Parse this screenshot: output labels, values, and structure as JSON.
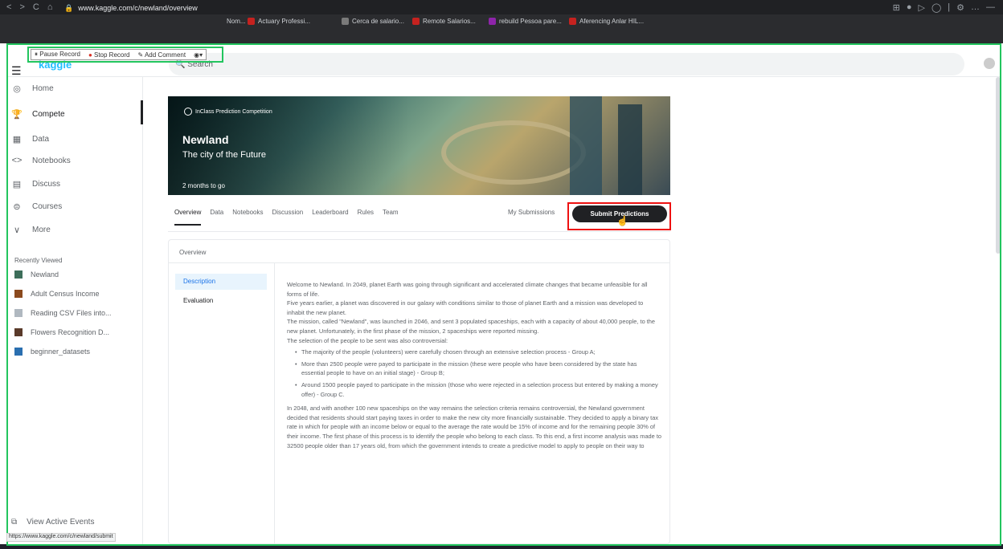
{
  "browser": {
    "url": "www.kaggle.com/c/newland/overview",
    "nav_buttons": [
      "<",
      ">",
      "C",
      "⌂"
    ],
    "right_icons": [
      "⊞",
      "●",
      "▷",
      "◯",
      "|",
      "⚙",
      "…",
      "—"
    ]
  },
  "bookmarks": [
    {
      "label": "Nom...",
      "color": "#7a7a7a"
    },
    {
      "label": "Actuary Professi...",
      "color": "#c5221f"
    },
    {
      "label": "Cerca de salario...",
      "color": "#7a7a7a"
    },
    {
      "label": "Remote Salarios...",
      "color": "#c5221f"
    },
    {
      "label": "rebuild Pessoa pare...",
      "color": "#8e24aa"
    },
    {
      "label": "Aferencing Anlar HIL...",
      "color": "#c5221f"
    }
  ],
  "recorder": {
    "pause": "Pause Record",
    "stop": "Stop Record",
    "comment": "Add Comment"
  },
  "header": {
    "logo": "kaggle",
    "search_placeholder": "Search"
  },
  "sidebar": {
    "items": [
      {
        "label": "Home",
        "icon": "◎"
      },
      {
        "label": "Compete",
        "icon": "🏆"
      },
      {
        "label": "Data",
        "icon": "▦"
      },
      {
        "label": "Notebooks",
        "icon": "<>"
      },
      {
        "label": "Discuss",
        "icon": "▤"
      },
      {
        "label": "Courses",
        "icon": "⊜"
      },
      {
        "label": "More",
        "icon": "∨"
      }
    ],
    "recent_title": "Recently Viewed",
    "recent": [
      {
        "label": "Newland",
        "color": "#3d6e5a"
      },
      {
        "label": "Adult Census Income",
        "color": "#8b4a1e"
      },
      {
        "label": "Reading CSV Files into...",
        "color": "#b0b8c0"
      },
      {
        "label": "Flowers Recognition D...",
        "color": "#5a3a2a"
      },
      {
        "label": "beginner_datasets",
        "color": "#2a6fb0"
      }
    ],
    "view_events": "View Active Events"
  },
  "status_url": "https://www.kaggle.com/c/newland/submit",
  "competition": {
    "type": "InClass Prediction Competition",
    "title": "Newland",
    "subtitle": "The city of the Future",
    "time_left": "2 months to go"
  },
  "tabs": [
    "Overview",
    "Data",
    "Notebooks",
    "Discussion",
    "Leaderboard",
    "Rules",
    "Team"
  ],
  "my_submissions": "My Submissions",
  "submit_button": "Submit Predictions",
  "overview": {
    "heading": "Overview",
    "nav": [
      "Description",
      "Evaluation"
    ],
    "para1": "Welcome to Newland. In 2049, planet Earth was going through significant and accelerated climate changes that became unfeasible for all forms of life.",
    "para2": "Five years earlier, a planet was discovered in our galaxy with conditions similar to those of planet Earth and a mission was developed to inhabit the new planet.",
    "para3": "The mission, called \"Newland\", was launched in 2046, and sent 3 populated spaceships, each with a capacity of about 40,000 people, to the new planet. Unfortunately, in the first phase of the mission, 2 spaceships were reported missing.",
    "para4": "The selection of the people to be sent was also controversial:",
    "bullets": [
      "The majority of the people (volunteers) were carefully chosen through an extensive selection process - Group A;",
      "More than 2500 people were payed to participate in the mission (these were people who have been considered by the state has essential people to have on an initial stage) - Group B;",
      "Around 1500 people payed to participate in the mission (those who were rejected in a selection process but entered by making a money offer) - Group C."
    ],
    "para5": "In 2048, and with another 100 new spaceships on the way remains the selection criteria remains controversial, the Newland government decided that residents should start paying taxes in order to make the new city more financially sustainable. They decided to apply a binary tax rate in which for people with an income below or equal to the average the rate would be 15% of income and for the remaining people 30% of their income. The first phase of this process is to identify the people who belong to each class. To this end, a first income analysis was made to 32500 people older than 17 years old, from which the government intends to create a predictive model to apply to people on their way to"
  }
}
